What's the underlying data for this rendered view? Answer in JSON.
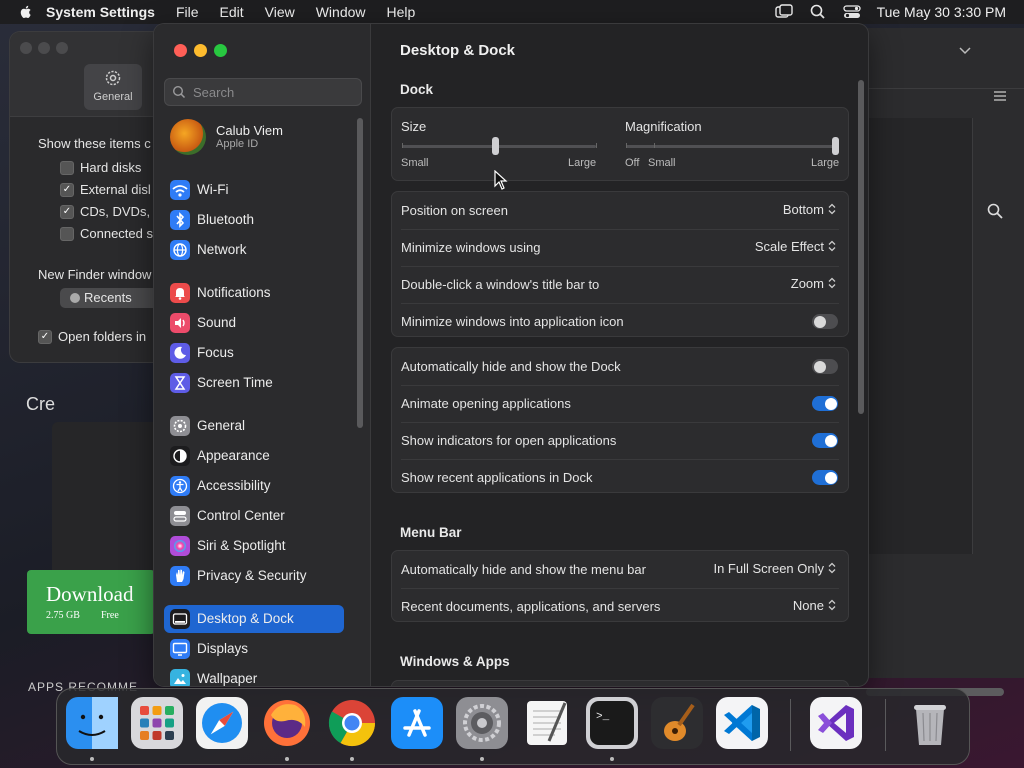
{
  "menubar": {
    "app_name": "System Settings",
    "items": [
      "File",
      "Edit",
      "View",
      "Window",
      "Help"
    ],
    "datetime": "Tue May 30  3:30 PM"
  },
  "bg_window": {
    "general_label": "General",
    "show_items_label": "Show these items c",
    "items": [
      {
        "label": "Hard disks",
        "checked": false
      },
      {
        "label": "External disl",
        "checked": true
      },
      {
        "label": "CDs, DVDs,",
        "checked": true
      },
      {
        "label": "Connected s",
        "checked": false
      }
    ],
    "new_window_label": "New Finder window",
    "recents_label": "Recents",
    "open_folders_label": "Open folders in"
  },
  "bg_left": {
    "cre_text": "Cre",
    "download_title": "Download",
    "download_size": "2.75 GB",
    "download_price": "Free",
    "apps_text": "APPS RECOMME"
  },
  "sidebar": {
    "search_placeholder": "Search",
    "profile_name": "Calub Viem",
    "profile_sub": "Apple ID",
    "items": [
      {
        "label": "Wi-Fi",
        "icon": "wifi-icon",
        "color": "#2f7cf6"
      },
      {
        "label": "Bluetooth",
        "icon": "bluetooth-icon",
        "color": "#2f7cf6"
      },
      {
        "label": "Network",
        "icon": "network-globe-icon",
        "color": "#2f7cf6"
      },
      {
        "label": "Notifications",
        "icon": "notifications-bell-icon",
        "color": "#ec4b4b"
      },
      {
        "label": "Sound",
        "icon": "speaker-icon",
        "color": "#ec4b6a"
      },
      {
        "label": "Focus",
        "icon": "moon-icon",
        "color": "#5e5ce6"
      },
      {
        "label": "Screen Time",
        "icon": "hourglass-icon",
        "color": "#5e5ce6"
      },
      {
        "label": "General",
        "icon": "gear-icon",
        "color": "#8e8e93"
      },
      {
        "label": "Appearance",
        "icon": "appearance-icon",
        "color": "#1c1c1e"
      },
      {
        "label": "Accessibility",
        "icon": "accessibility-icon",
        "color": "#2f7cf6"
      },
      {
        "label": "Control Center",
        "icon": "control-center-icon",
        "color": "#8e8e93"
      },
      {
        "label": "Siri & Spotlight",
        "icon": "siri-icon",
        "color": "#b04cd9"
      },
      {
        "label": "Privacy & Security",
        "icon": "hand-icon",
        "color": "#2f7cf6"
      },
      {
        "label": "Desktop & Dock",
        "icon": "dock-icon",
        "color": "#1c1c1e"
      },
      {
        "label": "Displays",
        "icon": "display-icon",
        "color": "#2f7cf6"
      },
      {
        "label": "Wallpaper",
        "icon": "wallpaper-icon",
        "color": "#36b3e0"
      }
    ],
    "active_index": 13
  },
  "content": {
    "title": "Desktop & Dock",
    "dock_section": "Dock",
    "size_label": "Size",
    "size_small": "Small",
    "size_large": "Large",
    "size_value": 0.48,
    "mag_label": "Magnification",
    "mag_off": "Off",
    "mag_small": "Small",
    "mag_large": "Large",
    "mag_value": 1.0,
    "rows_group1": [
      {
        "label": "Position on screen",
        "value": "Bottom"
      },
      {
        "label": "Minimize windows using",
        "value": "Scale Effect"
      },
      {
        "label": "Double-click a window's title bar to",
        "value": "Zoom"
      },
      {
        "label": "Minimize windows into application icon",
        "toggle": false
      }
    ],
    "rows_group2": [
      {
        "label": "Automatically hide and show the Dock",
        "toggle": false
      },
      {
        "label": "Animate opening applications",
        "toggle": true
      },
      {
        "label": "Show indicators for open applications",
        "toggle": true
      },
      {
        "label": "Show recent applications in Dock",
        "toggle": true
      }
    ],
    "menubar_section": "Menu Bar",
    "rows_group3": [
      {
        "label": "Automatically hide and show the menu bar",
        "value": "In Full Screen Only"
      },
      {
        "label": "Recent documents, applications, and servers",
        "value": "None"
      }
    ],
    "windows_section": "Windows & Apps"
  },
  "dock": {
    "apps": [
      {
        "name": "finder-icon",
        "running": true
      },
      {
        "name": "launchpad-icon",
        "running": false
      },
      {
        "name": "safari-icon",
        "running": false
      },
      {
        "name": "firefox-icon",
        "running": true
      },
      {
        "name": "chrome-icon",
        "running": true
      },
      {
        "name": "app-store-icon",
        "running": false
      },
      {
        "name": "system-settings-icon",
        "running": true
      },
      {
        "name": "textedit-icon",
        "running": false
      },
      {
        "name": "terminal-icon",
        "running": true
      },
      {
        "name": "garageband-icon",
        "running": false
      },
      {
        "name": "vscode-icon",
        "running": false
      },
      {
        "name": "visual-studio-icon",
        "running": false
      },
      {
        "name": "trash-icon",
        "running": false
      }
    ]
  }
}
